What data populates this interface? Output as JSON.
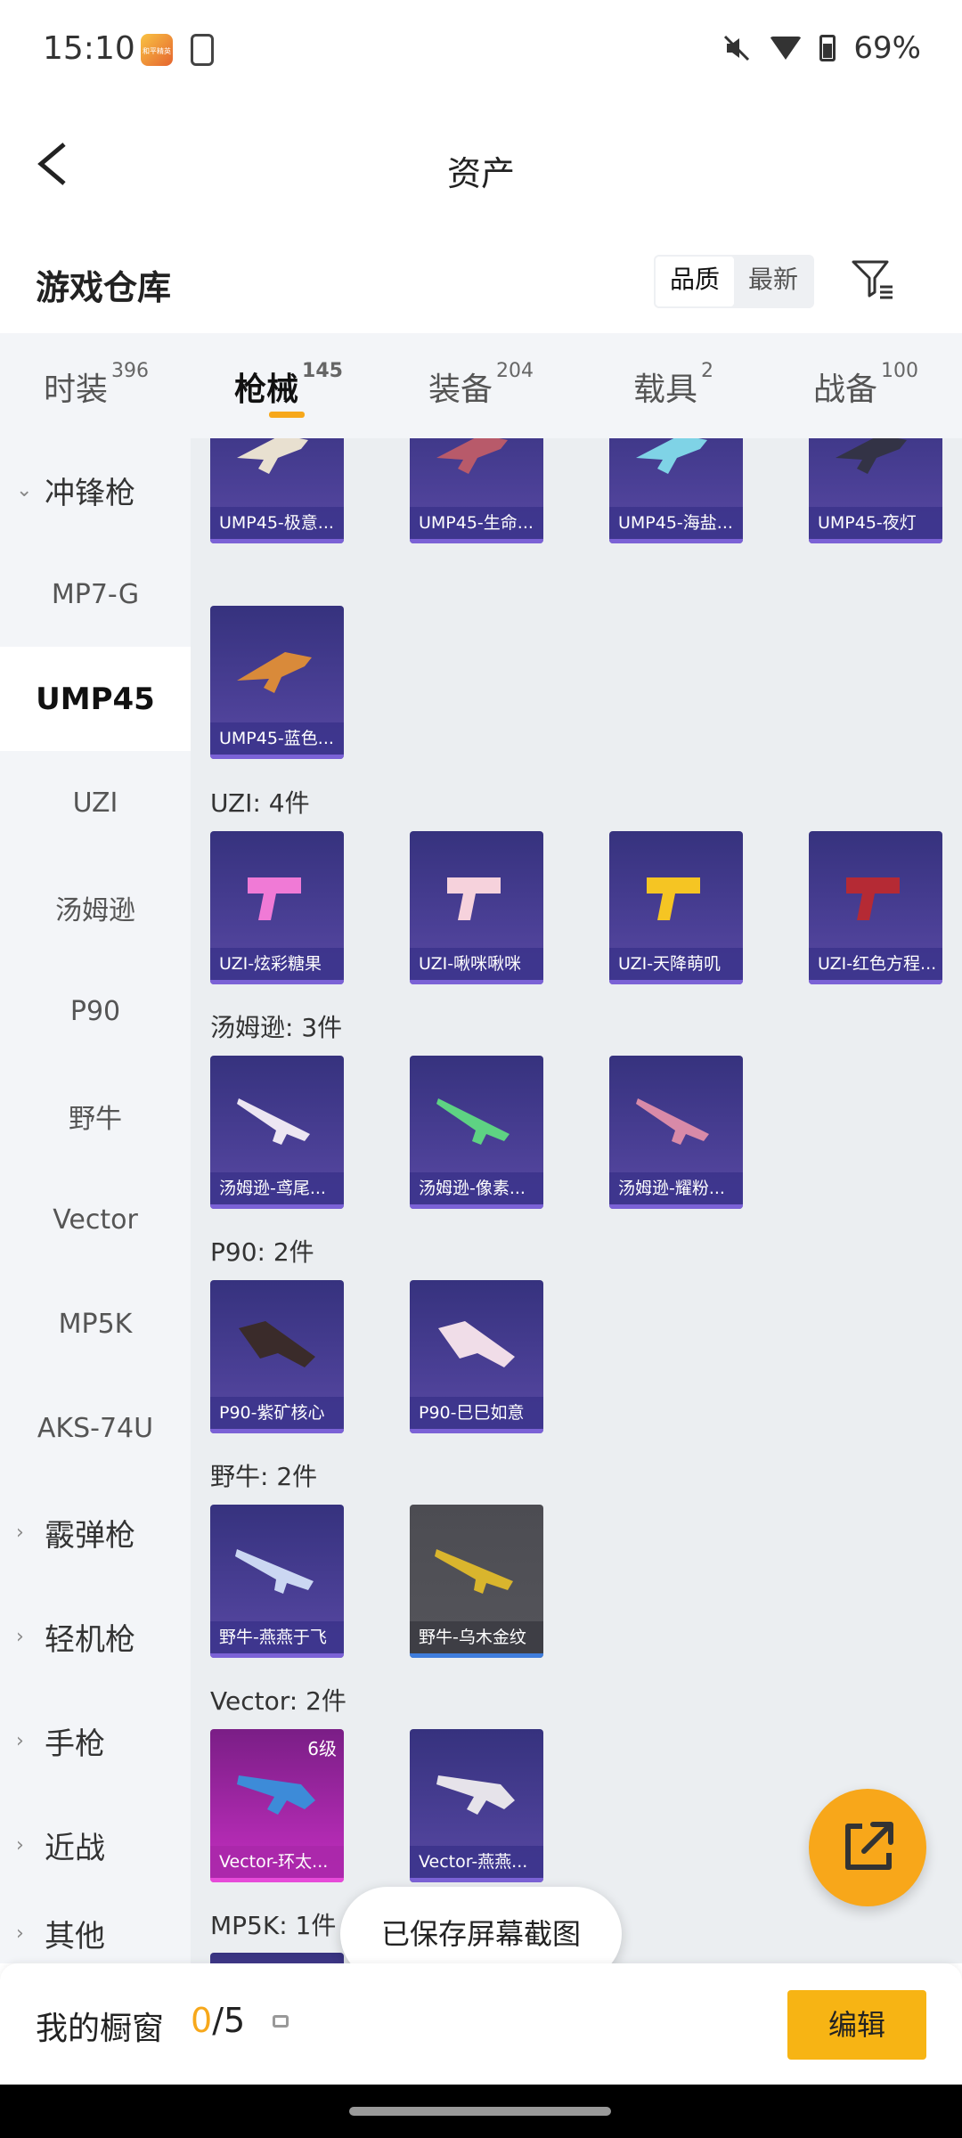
{
  "status": {
    "time": "15:10",
    "battery": "69%",
    "app_badge": "和平精英"
  },
  "header": {
    "title": "资产"
  },
  "warehouse": {
    "title": "游戏仓库",
    "sort_options": [
      "品质",
      "最新"
    ]
  },
  "tabs": [
    {
      "label": "时装",
      "count": "396"
    },
    {
      "label": "枪械",
      "count": "145"
    },
    {
      "label": "装备",
      "count": "204"
    },
    {
      "label": "载具",
      "count": "2"
    },
    {
      "label": "战备",
      "count": "100"
    }
  ],
  "sidebar": [
    {
      "label": "冲锋枪",
      "type": "category",
      "chev": "⌄"
    },
    {
      "label": "MP7-G",
      "type": "sub"
    },
    {
      "label": "UMP45",
      "type": "sub-active"
    },
    {
      "label": "UZI",
      "type": "sub"
    },
    {
      "label": "汤姆逊",
      "type": "sub"
    },
    {
      "label": "P90",
      "type": "sub"
    },
    {
      "label": "野牛",
      "type": "sub"
    },
    {
      "label": "Vector",
      "type": "sub"
    },
    {
      "label": "MP5K",
      "type": "sub"
    },
    {
      "label": "AKS-74U",
      "type": "sub"
    },
    {
      "label": "霰弹枪",
      "type": "category",
      "chev": "›"
    },
    {
      "label": "轻机枪",
      "type": "category",
      "chev": "›"
    },
    {
      "label": "手枪",
      "type": "category",
      "chev": "›"
    },
    {
      "label": "近战",
      "type": "category",
      "chev": "›"
    },
    {
      "label": "其他",
      "type": "category",
      "chev": "›"
    }
  ],
  "sections": {
    "ump45_items": [
      "UMP45-极意...",
      "UMP45-生命...",
      "UMP45-海盐...",
      "UMP45-夜灯",
      "UMP45-蓝色..."
    ],
    "uzi_title": "UZI: 4件",
    "uzi_items": [
      "UZI-炫彩糖果",
      "UZI-啾咪啾咪",
      "UZI-天降萌叽",
      "UZI-红色方程..."
    ],
    "thompson_title": "汤姆逊: 3件",
    "thompson_items": [
      "汤姆逊-鸢尾...",
      "汤姆逊-像素...",
      "汤姆逊-耀粉..."
    ],
    "p90_title": "P90: 2件",
    "p90_items": [
      "P90-紫矿核心",
      "P90-巳巳如意"
    ],
    "bison_title": "野牛: 2件",
    "bison_items": [
      "野牛-燕燕于飞",
      "野牛-乌木金纹"
    ],
    "vector_title": "Vector: 2件",
    "vector_items": [
      "Vector-环太...",
      "Vector-燕燕..."
    ],
    "vector_level": "6级",
    "mp5k_title": "MP5K: 1件"
  },
  "toast": "已保存屏幕截图",
  "bottom": {
    "label": "我的橱窗",
    "current": "0",
    "total": "/5",
    "edit": "编辑"
  },
  "colors": {
    "accent": "#f7a81b",
    "item_purple": "#3d3688"
  }
}
